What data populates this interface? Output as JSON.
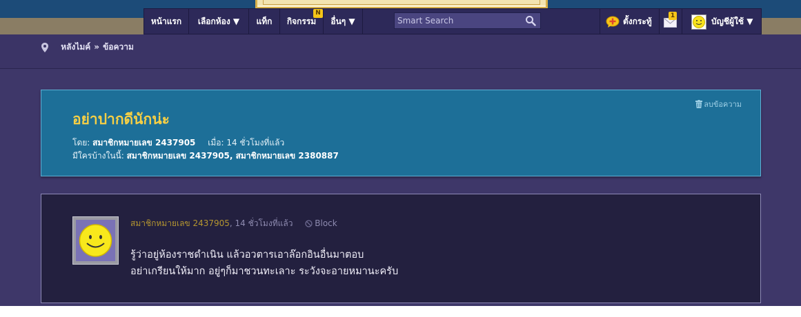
{
  "nav": {
    "home": "หน้าแรก",
    "rooms": "เลือกห้อง ▼",
    "tags": "แท็ก",
    "activities": "กิจกรรม",
    "activities_badge": "N",
    "more": "อื่นๆ ▼",
    "search_placeholder": "Smart Search",
    "set_topic": "ตั้งกระทู้",
    "mail_badge": "1",
    "account": "บัญชีผู้ใช้ ▼"
  },
  "breadcrumb": {
    "root": "หลังไมค์",
    "separator": "»",
    "current": "ข้อความ"
  },
  "thread": {
    "delete_label": "ลบข้อความ",
    "title": "อย่าปากดีนักน่ะ",
    "by_label": "โดย:",
    "author": "สมาชิกหมายเลข 2437905",
    "when_label": "เมื่อ:",
    "when": "14 ชั่วโมงที่แล้ว",
    "participants_label": "มีใครบ้างในนี้:",
    "participants": "สมาชิกหมายเลข 2437905, สมาชิกหมายเลข 2380887"
  },
  "post": {
    "author": "สมาชิกหมายเลข 2437905",
    "time": ", 14 ชั่วโมงที่แล้ว",
    "block_label": "Block",
    "line1": "รู้ว่าอยู่ห้องราชดำเนิน แล้วอวตารเอาล๊อกอินอื่นมาตอบ",
    "line2": "อย่าเกรียนให้มาก อยู่ๆก็มาชวนทะเลาะ ระวังจะอายหมานะครับ"
  },
  "colors": {
    "accent_title": "#f6cf45",
    "thread_card": "#1d6f98",
    "background": "#3b3466"
  }
}
